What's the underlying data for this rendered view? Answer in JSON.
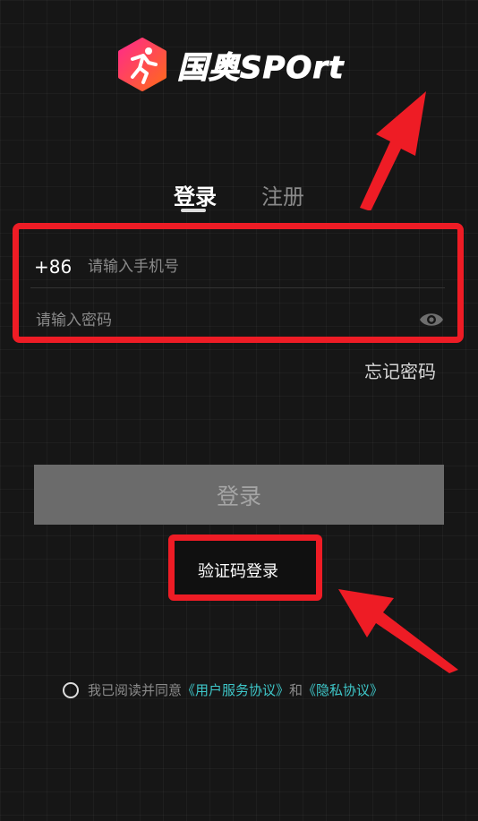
{
  "brand": {
    "name": "国奥SPOrt"
  },
  "tabs": {
    "login": "登录",
    "register": "注册"
  },
  "form": {
    "country_code": "+86",
    "phone_placeholder": "请输入手机号",
    "password_placeholder": "请输入密码"
  },
  "forgot_password": "忘记密码",
  "login_button": "登录",
  "code_login": "验证码登录",
  "agreement": {
    "prefix": "我已阅读并同意",
    "terms": "《用户服务协议》",
    "and": "和",
    "privacy": "《隐私协议》"
  },
  "colors": {
    "accent_red": "#ee1c25",
    "link_teal": "#3ec7c9",
    "background": "#161616"
  }
}
